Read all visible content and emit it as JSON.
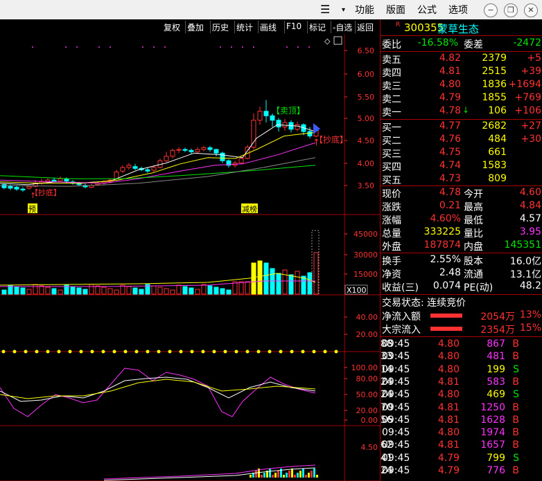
{
  "menu": {
    "func": "功能",
    "layout": "版面",
    "formula": "公式",
    "options": "选项"
  },
  "toolbar": [
    "复权",
    "叠加",
    "历史",
    "统计",
    "画线",
    "F10",
    "标记",
    "-自选",
    "返回"
  ],
  "price_axis": [
    "6.50",
    "6.00",
    "5.50",
    "5.00",
    "4.50",
    "4.00",
    "3.50"
  ],
  "vol_axis": [
    "45000",
    "30000",
    "15000"
  ],
  "vol_unit": "X100",
  "ind1_axis": [
    "40.00",
    "20.00"
  ],
  "kdj_axis": [
    "100.00",
    "80.00",
    "50.00",
    "20.00",
    "0.00"
  ],
  "ind3_axis": [
    "4.50"
  ],
  "annotations": {
    "sell_top": "【卖顶】",
    "buy_bottom": "【抄底】",
    "buy_bottom2": "【抄底】",
    "tag_yu": "预",
    "tag_jian": "减榜"
  },
  "stock": {
    "r": "R",
    "code": "300355",
    "name": "蒙草生态"
  },
  "weibi": {
    "l1": "委比",
    "v1": "-16.58%",
    "l2": "委差",
    "v2": "-2472"
  },
  "asks": [
    {
      "label": "卖五",
      "price": "4.82",
      "vol": "2379",
      "chg": "+5"
    },
    {
      "label": "卖四",
      "price": "4.81",
      "vol": "2515",
      "chg": "+39"
    },
    {
      "label": "卖三",
      "price": "4.80",
      "vol": "1836",
      "chg": "+1694"
    },
    {
      "label": "卖二",
      "price": "4.79",
      "vol": "1855",
      "chg": "+769"
    },
    {
      "label": "卖一",
      "price": "4.78",
      "vol": "106",
      "chg": "+106"
    }
  ],
  "bids": [
    {
      "label": "买一",
      "price": "4.77",
      "vol": "2682",
      "chg": "+27"
    },
    {
      "label": "买二",
      "price": "4.76",
      "vol": "484",
      "chg": "+30"
    },
    {
      "label": "买三",
      "price": "4.75",
      "vol": "661",
      "chg": ""
    },
    {
      "label": "买四",
      "price": "4.74",
      "vol": "1583",
      "chg": ""
    },
    {
      "label": "买五",
      "price": "4.73",
      "vol": "809",
      "chg": ""
    }
  ],
  "quote": [
    {
      "l1": "现价",
      "v1": "4.78",
      "l2": "今开",
      "v2": "4.60"
    },
    {
      "l1": "涨跌",
      "v1": "0.21",
      "l2": "最高",
      "v2": "4.84"
    },
    {
      "l1": "涨幅",
      "v1": "4.60%",
      "l2": "最低",
      "v2": "4.57"
    },
    {
      "l1": "总量",
      "v1": "333225",
      "l2": "量比",
      "v2": "3.95"
    },
    {
      "l1": "外盘",
      "v1": "187874",
      "l2": "内盘",
      "v2": "145351"
    }
  ],
  "extra": [
    {
      "l1": "换手",
      "v1": "2.55%",
      "l2": "股本",
      "v2": "16.0亿"
    },
    {
      "l1": "净资",
      "v1": "2.48",
      "l2": "流通",
      "v2": "13.1亿"
    },
    {
      "l1": "收益(三)",
      "v1": "0.074",
      "l2": "PE(动)",
      "v2": "48.2"
    }
  ],
  "trade_status": "交易状态: 连续竞价",
  "flows": [
    {
      "label": "净流入额",
      "amount": "2054万",
      "pct": "13%"
    },
    {
      "label": "大宗流入",
      "amount": "2354万",
      "pct": "15%"
    }
  ],
  "ticks": [
    {
      "t": "09:45",
      "p": "4.80",
      "v": "867",
      "s": "B",
      "n": "88"
    },
    {
      "t": "09:45",
      "p": "4.80",
      "v": "481",
      "s": "B",
      "n": "33"
    },
    {
      "t": "09:45",
      "p": "4.80",
      "v": "199",
      "s": "S",
      "n": "14"
    },
    {
      "t": "09:45",
      "p": "4.81",
      "v": "583",
      "s": "B",
      "n": "24"
    },
    {
      "t": "09:45",
      "p": "4.80",
      "v": "469",
      "s": "S",
      "n": "24"
    },
    {
      "t": "09:45",
      "p": "4.81",
      "v": "1250",
      "s": "B",
      "n": "70"
    },
    {
      "t": "09:45",
      "p": "4.81",
      "v": "1628",
      "s": "B",
      "n": "56"
    },
    {
      "t": "09:45",
      "p": "4.80",
      "v": "1974",
      "s": "B",
      "n": ""
    },
    {
      "t": "09:45",
      "p": "4.81",
      "v": "1657",
      "s": "B",
      "n": "62"
    },
    {
      "t": "09:45",
      "p": "4.79",
      "v": "799",
      "s": "S",
      "n": "41"
    },
    {
      "t": "09:45",
      "p": "4.79",
      "v": "776",
      "s": "B",
      "n": "24"
    }
  ],
  "colors": {
    "up": "#ff3232",
    "down": "#00ffff",
    "ma5": "#ffffff",
    "ma10": "#ffff00",
    "ma20": "#ff32ff",
    "ma60": "#00e600",
    "frame": "#aa0000"
  }
}
